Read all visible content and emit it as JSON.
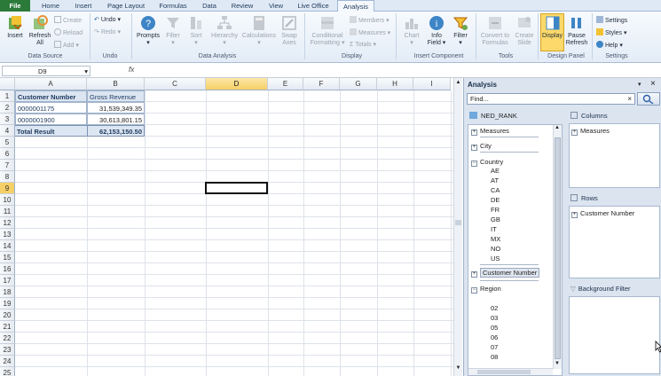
{
  "ribbon_tabs": [
    "File",
    "Home",
    "Insert",
    "Page Layout",
    "Formulas",
    "Data",
    "Review",
    "View",
    "Live Office",
    "Analysis"
  ],
  "ribbon": {
    "data_source": {
      "insert": "Insert",
      "refresh_line1": "Refresh",
      "refresh_line2": "All",
      "create": "Create",
      "reload": "Reload",
      "add": "Add",
      "group": "Data Source"
    },
    "undo": {
      "undo": "Undo",
      "redo": "Redo",
      "group": "Undo"
    },
    "data_analysis": {
      "prompts": "Prompts",
      "filter": "Filter",
      "sort": "Sort",
      "hierarchy": "Hierarchy",
      "calculations": "Calculations",
      "swap_line1": "Swap",
      "swap_line2": "Axes",
      "group": "Data Analysis"
    },
    "display": {
      "conditional_line1": "Conditional",
      "conditional_line2": "Formatting",
      "members": "Members",
      "measures": "Measures",
      "totals": "Totals",
      "group": "Display"
    },
    "insert_component": {
      "chart": "Chart",
      "info_line1": "Info",
      "info_line2": "Field",
      "filter": "Filter",
      "group": "Insert Component"
    },
    "tools": {
      "convert_line1": "Convert to",
      "convert_line2": "Formulas",
      "create_line1": "Create",
      "create_line2": "Slide",
      "group": "Tools"
    },
    "design_panel": {
      "display": "Display",
      "pause_line1": "Pause",
      "pause_line2": "Refresh",
      "group": "Design Panel"
    },
    "settings": {
      "settings": "Settings",
      "styles": "Styles",
      "help": "Help",
      "group": "Settings"
    }
  },
  "formula_bar": {
    "name_box": "D9",
    "fx": "fx",
    "formula": ""
  },
  "sheet": {
    "columns": [
      "A",
      "B",
      "C",
      "D",
      "E",
      "F",
      "G",
      "H",
      "I"
    ],
    "rows": [
      "1",
      "2",
      "3",
      "4",
      "5",
      "6",
      "7",
      "8",
      "9",
      "10",
      "11",
      "12",
      "13",
      "14",
      "15",
      "16",
      "17",
      "18",
      "19",
      "20",
      "21",
      "22",
      "23",
      "24",
      "25"
    ],
    "header": {
      "a": "Customer Number",
      "b": "Gross Revenue"
    },
    "data": [
      {
        "a": "0000001175",
        "b": "31,539,349.35"
      },
      {
        "a": "0000001900",
        "b": "30,613,801.15"
      }
    ],
    "total": {
      "a": "Total Result",
      "b": "62,153,150.50"
    },
    "selected_cell": "D9"
  },
  "analysis_pane": {
    "title": "Analysis",
    "find_placeholder": "Find...",
    "source": "NED_RANK",
    "tree": {
      "measures": "Measures",
      "city": "City",
      "country": "Country",
      "countries": [
        "AE",
        "AT",
        "CA",
        "DE",
        "FR",
        "GB",
        "IT",
        "MX",
        "NO",
        "US"
      ],
      "customer_number": "Customer Number",
      "region": "Region",
      "regions": [
        "02",
        "03",
        "05",
        "06",
        "07",
        "08"
      ]
    },
    "columns_label": "Columns",
    "columns_items": [
      "Measures"
    ],
    "rows_label": "Rows",
    "rows_items": [
      "Customer Number"
    ],
    "background_filter_label": "Background Filter"
  }
}
